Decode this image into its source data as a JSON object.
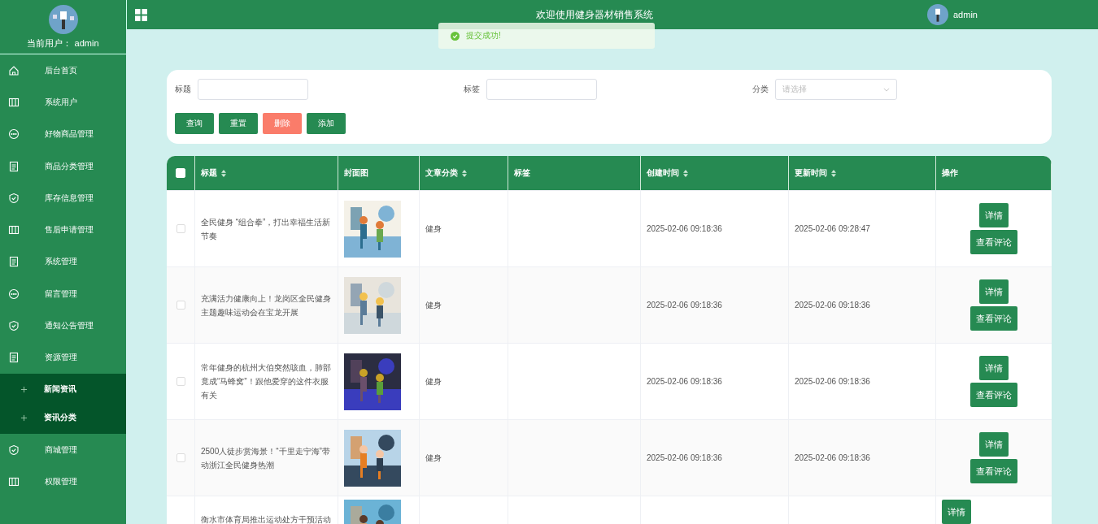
{
  "sidebar": {
    "current_user": "当前用户： admin",
    "items": [
      {
        "label": "后台首页"
      },
      {
        "label": "系统用户"
      },
      {
        "label": "好物商品管理"
      },
      {
        "label": "商品分类管理"
      },
      {
        "label": "库存信息管理"
      },
      {
        "label": "售后申请管理"
      },
      {
        "label": "系统管理"
      },
      {
        "label": "留言管理"
      },
      {
        "label": "通知公告管理"
      },
      {
        "label": "资源管理",
        "children": [
          {
            "label": "新闻资讯"
          },
          {
            "label": "资讯分类"
          }
        ]
      },
      {
        "label": "商城管理"
      },
      {
        "label": "权限管理"
      }
    ]
  },
  "header": {
    "title": "欢迎使用健身器材销售系统",
    "user": "admin"
  },
  "toast": {
    "kind": "success",
    "text": "提交成功!"
  },
  "search": {
    "fields": [
      {
        "label": "标题",
        "kind": "input"
      },
      {
        "label": "标签",
        "kind": "input"
      },
      {
        "label": "分类",
        "kind": "select",
        "placeholder": "请选择"
      }
    ],
    "buttons": [
      {
        "label": "查询",
        "kind": "primary"
      },
      {
        "label": "重置",
        "kind": "primary"
      },
      {
        "label": "删除",
        "kind": "danger"
      },
      {
        "label": "添加",
        "kind": "primary"
      }
    ]
  },
  "table": {
    "header_checked": false,
    "columns": [
      {
        "label": "标题",
        "sortable": true
      },
      {
        "label": "封面图",
        "sortable": false
      },
      {
        "label": "文章分类",
        "sortable": true
      },
      {
        "label": "标签",
        "sortable": false
      },
      {
        "label": "创建时间",
        "sortable": true
      },
      {
        "label": "更新时间",
        "sortable": true
      },
      {
        "label": "操作",
        "sortable": false
      }
    ],
    "rows": [
      {
        "checked": false,
        "title": "全民健身 “组合拳”，打出幸福生活新节奏",
        "category": "健身",
        "created": "2025-02-06 09:18:36",
        "updated": "2025-02-06 09:28:47",
        "actions": [
          "详情",
          "查看评论"
        ]
      },
      {
        "checked": false,
        "title": "充满活力健康向上！龙岗区全民健身主题趣味运动会在宝龙开展",
        "category": "健身",
        "created": "2025-02-06 09:18:36",
        "updated": "2025-02-06 09:18:36",
        "actions": [
          "详情",
          "查看评论"
        ]
      },
      {
        "checked": false,
        "title": "常年健身的杭州大伯突然咳血，肺部竟成“马蜂窝”！跟他爱穿的这件衣服有关",
        "category": "健身",
        "created": "2025-02-06 09:18:36",
        "updated": "2025-02-06 09:18:36",
        "actions": [
          "详情",
          "查看评论"
        ]
      },
      {
        "checked": false,
        "title": "2500人徒步赏海景！“千里走宁海”带动浙江全民健身热潮",
        "category": "健身",
        "created": "2025-02-06 09:18:36",
        "updated": "2025-02-06 09:18:36",
        "actions": [
          "详情",
          "查看评论"
        ]
      },
      {
        "title": "衡水市体育局推出运动处方干预活动",
        "actions": [
          "详情"
        ]
      }
    ]
  }
}
